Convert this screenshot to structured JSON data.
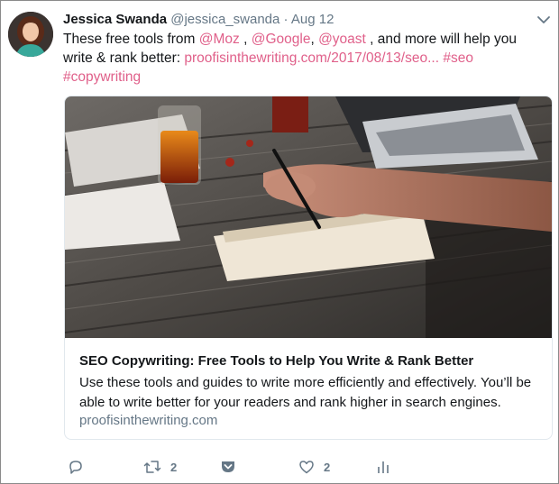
{
  "tweet": {
    "author_name": "Jessica Swanda",
    "author_handle": "@jessica_swanda",
    "separator": "·",
    "timestamp": "Aug 12",
    "text_before": "These free tools from ",
    "mention_1": "@Moz",
    "sep_1": " , ",
    "mention_2": "@Google",
    "sep_2": ", ",
    "mention_3": "@yoast",
    "text_middle": " , and more will help you write & rank better:  ",
    "url_text": "proofisinthewriting.com/2017/08/13/seo...",
    "space": " ",
    "hashtag_1": "#seo",
    "hashtag_2": "#copywriting"
  },
  "card": {
    "title": "SEO Copywriting: Free Tools to Help You Write & Rank Better",
    "description": "Use these tools and guides to write more efficiently and effectively. You’ll be able to write better for your readers and rank higher in search engines.",
    "domain": "proofisinthewriting.com"
  },
  "actions": {
    "reply_count": "",
    "retweet_count": "2",
    "like_count": "2"
  },
  "colors": {
    "link": "#e0608a",
    "muted": "#657786",
    "text": "#14171a"
  }
}
